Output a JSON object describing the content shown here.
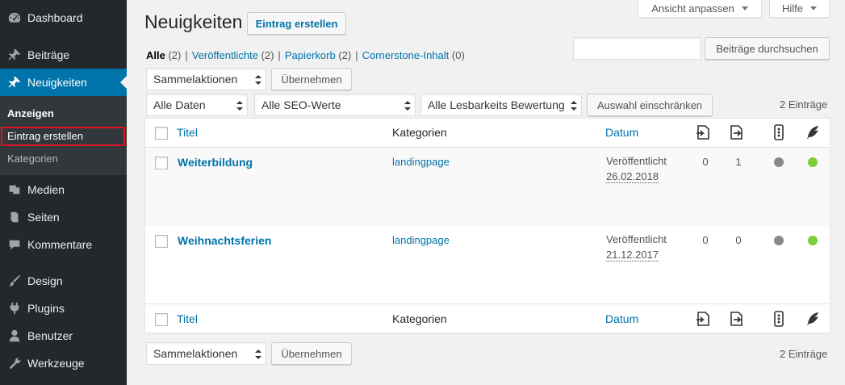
{
  "sidebar": {
    "items": [
      {
        "label": "Dashboard",
        "icon": "dashboard-icon"
      },
      {
        "label": "Beiträge",
        "icon": "pushpin-icon"
      },
      {
        "label": "Neuigkeiten",
        "icon": "pushpin-icon",
        "active": true
      },
      {
        "label": "Medien",
        "icon": "media-icon"
      },
      {
        "label": "Seiten",
        "icon": "pages-icon"
      },
      {
        "label": "Kommentare",
        "icon": "comment-icon"
      },
      {
        "label": "Design",
        "icon": "brush-icon"
      },
      {
        "label": "Plugins",
        "icon": "plugin-icon"
      },
      {
        "label": "Benutzer",
        "icon": "user-icon"
      },
      {
        "label": "Werkzeuge",
        "icon": "wrench-icon"
      }
    ],
    "submenu": [
      "Anzeigen",
      "Eintrag erstellen",
      "Kategorien"
    ],
    "accent": "#0073aa"
  },
  "header": {
    "title": "Neuigkeiten",
    "add_new": "Eintrag erstellen",
    "screen_options": "Ansicht anpassen",
    "help": "Hilfe"
  },
  "views": {
    "all_label": "Alle",
    "all_count": "(2)",
    "published_label": "Veröffentlichte",
    "published_count": "(2)",
    "trash_label": "Papierkorb",
    "trash_count": "(2)",
    "cornerstone_label": "Cornerstone-Inhalt",
    "cornerstone_count": "(0)"
  },
  "search": {
    "button": "Beiträge durchsuchen",
    "value": ""
  },
  "bulk": {
    "select": "Sammelaktionen",
    "apply": "Übernehmen"
  },
  "filters": {
    "dates": "Alle Daten",
    "seo": "Alle SEO-Werte",
    "readability": "Alle Lesbarkeits Bewertung",
    "apply": "Auswahl einschränken"
  },
  "item_count": "2 Einträge",
  "table": {
    "columns": {
      "title": "Titel",
      "categories": "Kategorien",
      "date": "Datum"
    },
    "rows": [
      {
        "title": "Weiterbildung",
        "category": "landingpage",
        "status": "Veröffentlicht",
        "date": "26.02.2018",
        "links_out": "0",
        "links_in": "1",
        "seo_color": "#888888",
        "read_color": "#7ad03a"
      },
      {
        "title": "Weihnachtsferien",
        "category": "landingpage",
        "status": "Veröffentlicht",
        "date": "21.12.2017",
        "links_out": "0",
        "links_in": "0",
        "seo_color": "#888888",
        "read_color": "#7ad03a"
      }
    ]
  },
  "colors": {
    "link": "#0073aa",
    "highlight_box": "#e0141e",
    "sidebar_bg": "#23282d"
  }
}
